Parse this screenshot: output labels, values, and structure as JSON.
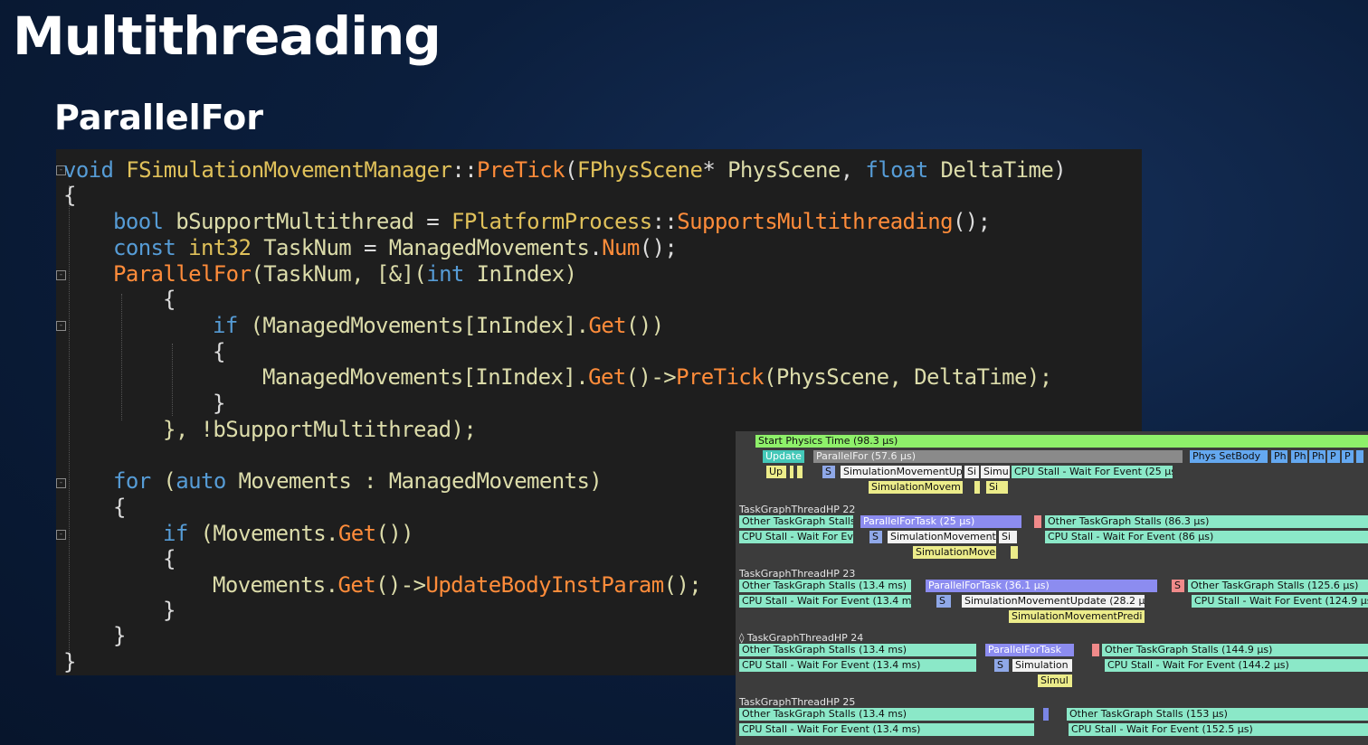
{
  "slide": {
    "title": "Multithreading",
    "subtitle": "ParallelFor"
  },
  "code": {
    "l1": {
      "kw": "void",
      "cls": " FSimulationMovementManager",
      "sep": "::",
      "fn": "PreTick",
      "o": "(",
      "ty": "FPhysScene",
      "star": "* ",
      "p1": "PhysScene",
      "c": ", ",
      "kw2": "float",
      "sp": " ",
      "p2": "DeltaTime",
      "cl": ")"
    },
    "l2": "{",
    "l3": {
      "kw": "bool",
      "var": " bSupportMultithread",
      "eq": " = ",
      "cls": "FPlatformProcess",
      "sep": "::",
      "fn": "SupportsMultithreading",
      "end": "();"
    },
    "l4": {
      "kw": "const",
      "ty": " int32",
      "var": " TaskNum",
      "eq": " = ",
      "obj": "ManagedMovements",
      "dot": ".",
      "fn": "Num",
      "end": "();"
    },
    "l5": {
      "fn": "ParallelFor",
      "a": "(TaskNum, [&](",
      "kw": "int",
      "b": " InIndex)"
    },
    "l6": "{",
    "l7": {
      "kw": "if",
      "a": " (ManagedMovements[InIndex].",
      "fn": "Get",
      "b": "())"
    },
    "l8": "{",
    "l9": {
      "a": "ManagedMovements[InIndex].",
      "fn": "Get",
      "b": "()->",
      "fn2": "PreTick",
      "c": "(PhysScene, DeltaTime);"
    },
    "l10": "}",
    "l11": "}, !bSupportMultithread);",
    "l12": {
      "kw": "for",
      "a": " (",
      "kw2": "auto",
      "b": " Movements : ManagedMovements)"
    },
    "l13": "{",
    "l14": {
      "kw": "if",
      "a": " (Movements.",
      "fn": "Get",
      "b": "())"
    },
    "l15": "{",
    "l16": {
      "a": "Movements.",
      "fn": "Get",
      "b": "()->",
      "fn2": "UpdateBodyInstParam",
      "c": "();"
    },
    "l17": "}",
    "l18": "}",
    "l19": "}"
  },
  "profiler": {
    "game": {
      "start_physics": "Start Physics Time (98.3 µs)",
      "update": "Update",
      "parallelfor": "ParallelFor (57.6 µs)",
      "phys_setbody": "Phys SetBody",
      "ph1": "Ph",
      "ph2": "Ph",
      "ph3": "Ph",
      "p1": "P",
      "p2": "P",
      "up": "Up",
      "s": "S",
      "sim_update": "SimulationMovementUp",
      "si": "Si",
      "simu": "Simu",
      "cpu_stall": "CPU Stall - Wait For Event (25 µs",
      "sim_movem": "SimulationMovem",
      "si2": "Si"
    },
    "t22": {
      "name": "TaskGraphThreadHP 22",
      "other1": "Other TaskGraph Stalls",
      "pft": "ParallelForTask (25 µs)",
      "other2": "Other TaskGraph Stalls (86.3 µs)",
      "cpu1": "CPU Stall - Wait For Ev",
      "s": "S",
      "simmov": "SimulationMovement",
      "si": "Si",
      "cpu2": "CPU Stall - Wait For Event (86 µs)",
      "simmove": "SimulationMove"
    },
    "t23": {
      "name": "TaskGraphThreadHP 23",
      "other1": "Other TaskGraph Stalls (13.4 ms)",
      "pft": "ParallelForTask (36.1 µs)",
      "s_pink": "S",
      "other2": "Other TaskGraph Stalls (125.6 µs)",
      "cpu1": "CPU Stall - Wait For Event (13.4 ms",
      "s": "S",
      "smu": "SimulationMovementUpdate (28.2 µs",
      "cpu2": "CPU Stall - Wait For Event (124.9 µs",
      "smp": "SimulationMovementPredi"
    },
    "t24": {
      "name": "◊ TaskGraphThreadHP 24",
      "other1": "Other TaskGraph Stalls (13.4 ms)",
      "pft": "ParallelForTask",
      "other2": "Other TaskGraph Stalls (144.9 µs)",
      "cpu1": "CPU Stall - Wait For Event (13.4 ms)",
      "s": "S",
      "sim": "Simulation",
      "cpu2": "CPU Stall - Wait For Event (144.2 µs)",
      "simu": "Simul"
    },
    "t25": {
      "name": "TaskGraphThreadHP 25",
      "other1": "Other TaskGraph Stalls (13.4 ms)",
      "other2": "Other TaskGraph Stalls (153 µs)",
      "cpu1": "CPU Stall - Wait For Event (13.4 ms)",
      "cpu2": "CPU Stall - Wait For Event (152.5 µs)"
    }
  }
}
